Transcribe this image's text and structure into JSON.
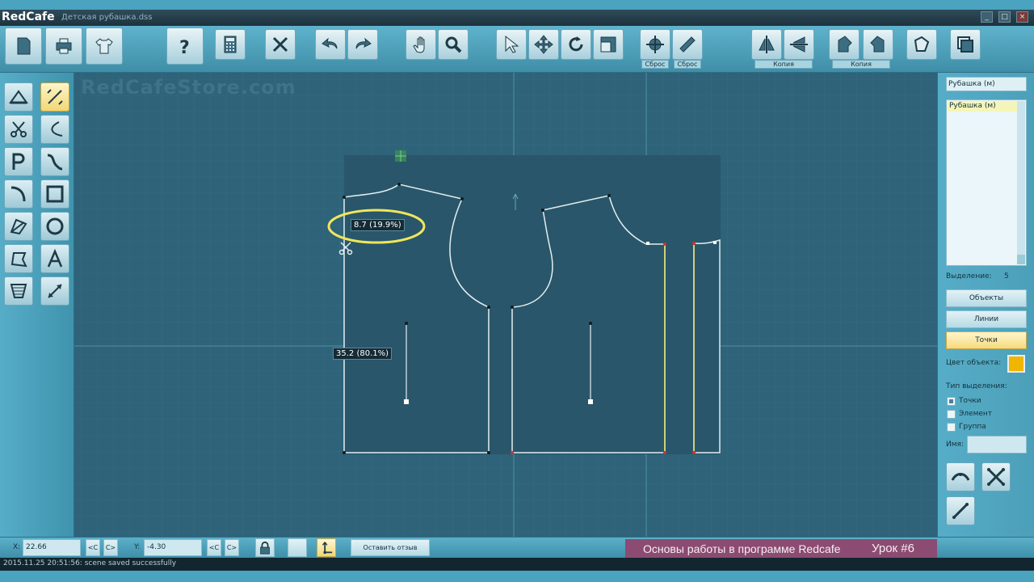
{
  "window": {
    "app_name": "RedCafe",
    "document_name": "Детская рубашка.dss"
  },
  "toolbar": {
    "labels": {
      "reset_1": "Сброс",
      "reset_2": "Сброс",
      "copy_1": "Копия",
      "copy_2": "Копия"
    }
  },
  "canvas": {
    "watermark": "RedCafeStore.com",
    "measure_1": "8.7 (19.9%)",
    "measure_2": "35.2 (80.1%)"
  },
  "right_panel": {
    "object_title": "Рубашка (м)",
    "list_items": [
      "Рубашка (м)"
    ],
    "selection_label": "Выделение:",
    "selection_count": "5",
    "btn_objects": "Объекты",
    "btn_lines": "Линии",
    "btn_points": "Точки",
    "color_label": "Цвет объекта:",
    "color_value": "#f1b500",
    "selection_type_label": "Тип выделения:",
    "options": [
      {
        "label": "Точки",
        "checked": true
      },
      {
        "label": "Элемент",
        "checked": false
      },
      {
        "label": "Группа",
        "checked": false
      }
    ],
    "name_label": "Имя:"
  },
  "bottom": {
    "x_label": "X:",
    "x_value": "22.66",
    "y_label": "Y:",
    "y_value": "-4.30",
    "prev_label": "<C",
    "next_label": "C>",
    "feedback_label": "Оставить отзыв",
    "lesson_title": "Основы работы в программе Redcafe",
    "lesson_number": "Урок #6"
  },
  "status": {
    "message": "2015.11.25 20:51:56: scene saved successfully"
  }
}
